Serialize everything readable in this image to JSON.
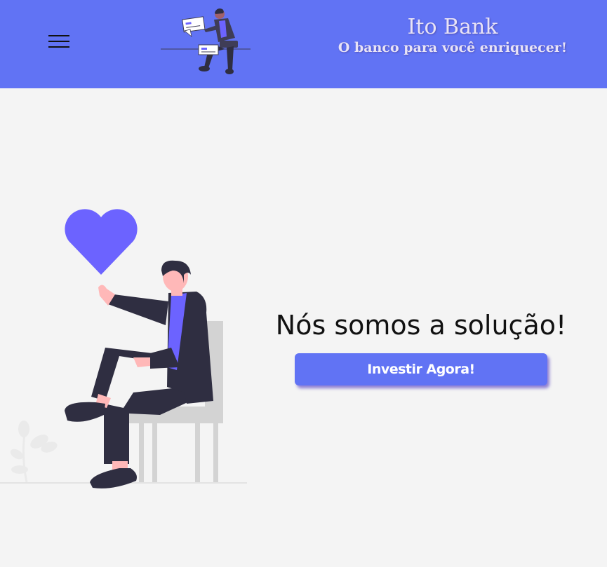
{
  "header": {
    "brand_title": "Ito Bank",
    "brand_subtitle": "O banco para você enriquecer!",
    "menu_icon": "hamburger-menu-icon",
    "illustration": "person-with-cheques-illustration"
  },
  "hero": {
    "heading": "Nós somos a solução!",
    "cta_label": "Investir Agora!",
    "illustration": "man-on-chair-with-heart-illustration"
  },
  "colors": {
    "header_bg": "#6173f4",
    "page_bg": "#f4f4f4",
    "accent_purple": "#6c63ff",
    "button_bg": "#6173f4",
    "brand_text": "#e8e3f6"
  }
}
